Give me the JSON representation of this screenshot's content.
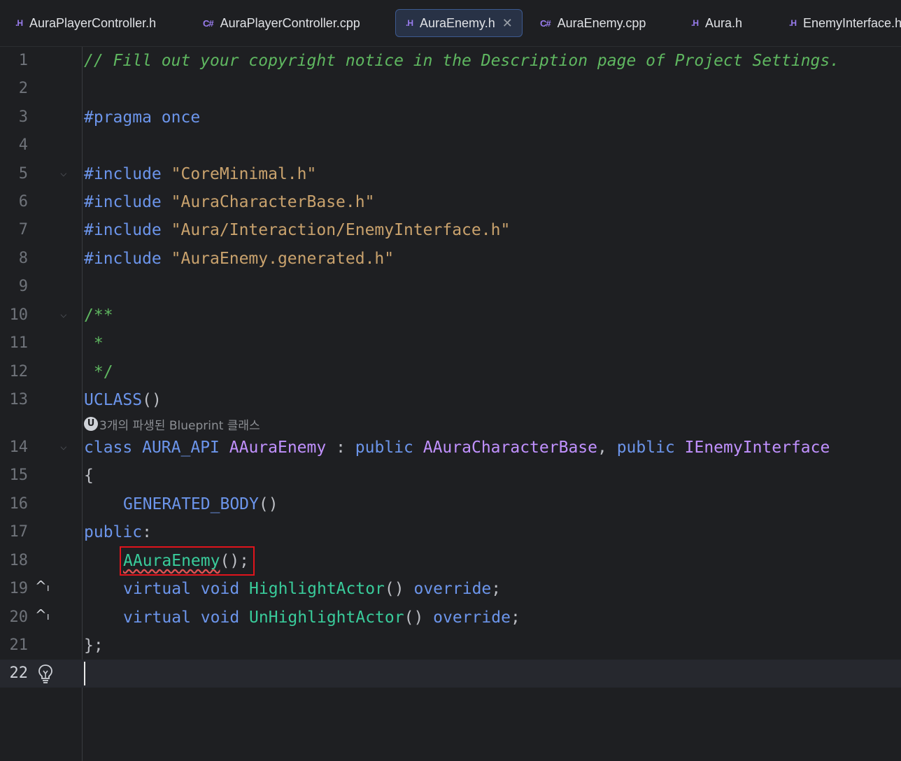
{
  "tabs": [
    {
      "icon": ".H",
      "label": "AuraPlayerController.h",
      "active": false
    },
    {
      "icon": "C#",
      "label": "AuraPlayerController.cpp",
      "active": false
    },
    {
      "icon": ".H",
      "label": "AuraEnemy.h",
      "active": true,
      "close": "✕"
    },
    {
      "icon": "C#",
      "label": "AuraEnemy.cpp",
      "active": false
    },
    {
      "icon": ".H",
      "label": "Aura.h",
      "active": false
    },
    {
      "icon": ".H",
      "label": "EnemyInterface.h",
      "active": false
    }
  ],
  "editor": {
    "line_numbers": [
      "1",
      "2",
      "3",
      "4",
      "5",
      "6",
      "7",
      "8",
      "9",
      "10",
      "11",
      "12",
      "13",
      "14",
      "15",
      "16",
      "17",
      "18",
      "19",
      "20",
      "21",
      "22"
    ],
    "current_line": "22",
    "inlay_hint": "3개의 파생된 Blueprint 클래스",
    "inlay_hint_icon": "unreal-engine-icon",
    "code": {
      "l1": "// Fill out your copyright notice in the Description page of Project Settings.",
      "l3_kw": "#pragma",
      "l3_rest": " once",
      "include": "#include",
      "l5_str": "\"CoreMinimal.h\"",
      "l6_str": "\"AuraCharacterBase.h\"",
      "l7_str": "\"Aura/Interaction/EnemyInterface.h\"",
      "l8_str": "\"AuraEnemy.generated.h\"",
      "l10": "/**",
      "l11": " *",
      "l12": " */",
      "l13_mac": "UCLASS",
      "l13_rest": "()",
      "l14_class": "class",
      "l14_api": "AURA_API",
      "l14_name": "AAuraEnemy",
      "l14_colon": " : ",
      "l14_public": "public",
      "l14_base": "AAuraCharacterBase",
      "l14_comma": ", ",
      "l14_public2": "public",
      "l14_iface": "IEnemyInterface",
      "l15": "{",
      "l16_mac": "GENERATED_BODY",
      "l16_rest": "()",
      "l17_kw": "public",
      "l17_rest": ":",
      "l18_fn": "AAuraEnemy",
      "l18_rest": "();",
      "virtual": "virtual",
      "void": "void",
      "l19_fn": "HighlightActor",
      "l20_fn": "UnHighlightActor",
      "parens": "()",
      "override": "override",
      "semi": ";",
      "l21": "};"
    }
  },
  "colors": {
    "background": "#1e1f22",
    "comment": "#5fb760",
    "keyword": "#6c95eb",
    "string": "#c9a26d",
    "class": "#c191ff",
    "function": "#39cc9b",
    "highlight_box": "#e0141c"
  }
}
